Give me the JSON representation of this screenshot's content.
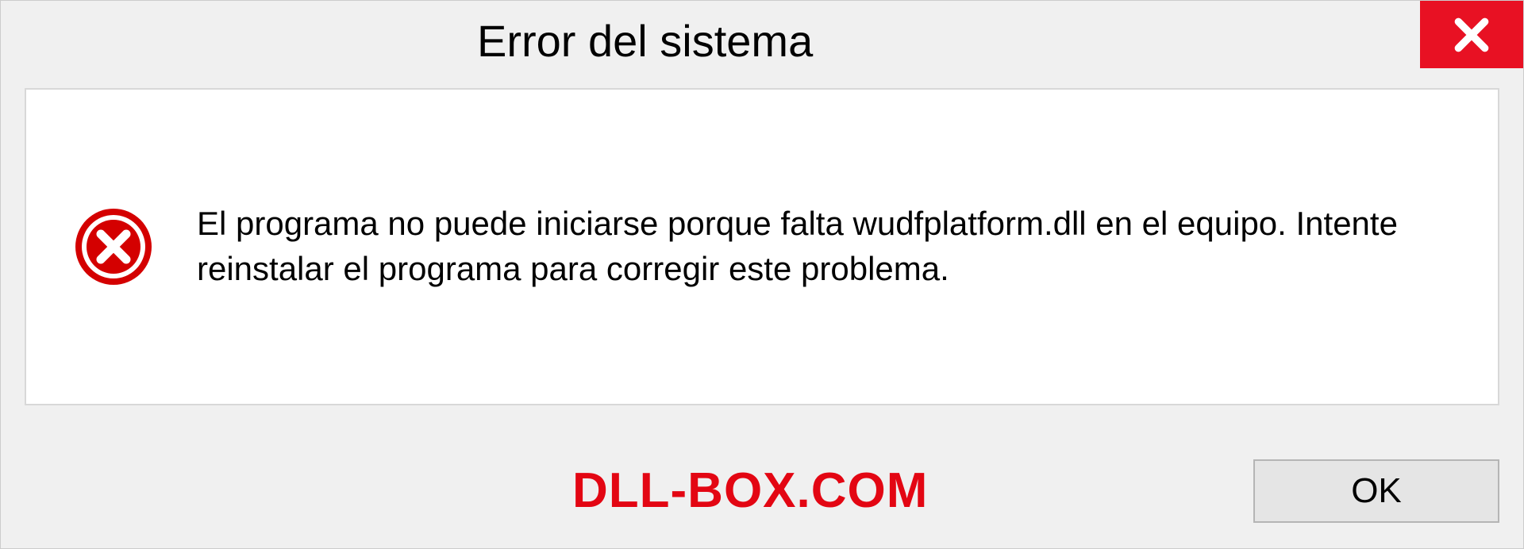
{
  "dialog": {
    "title": "Error del sistema",
    "message": "El programa no puede iniciarse porque falta wudfplatform.dll en el equipo. Intente reinstalar el programa para corregir este problema.",
    "ok_label": "OK"
  },
  "watermark": "DLL-BOX.COM",
  "colors": {
    "close_bg": "#e81123",
    "error_red": "#d40000",
    "watermark_red": "#e30613"
  }
}
